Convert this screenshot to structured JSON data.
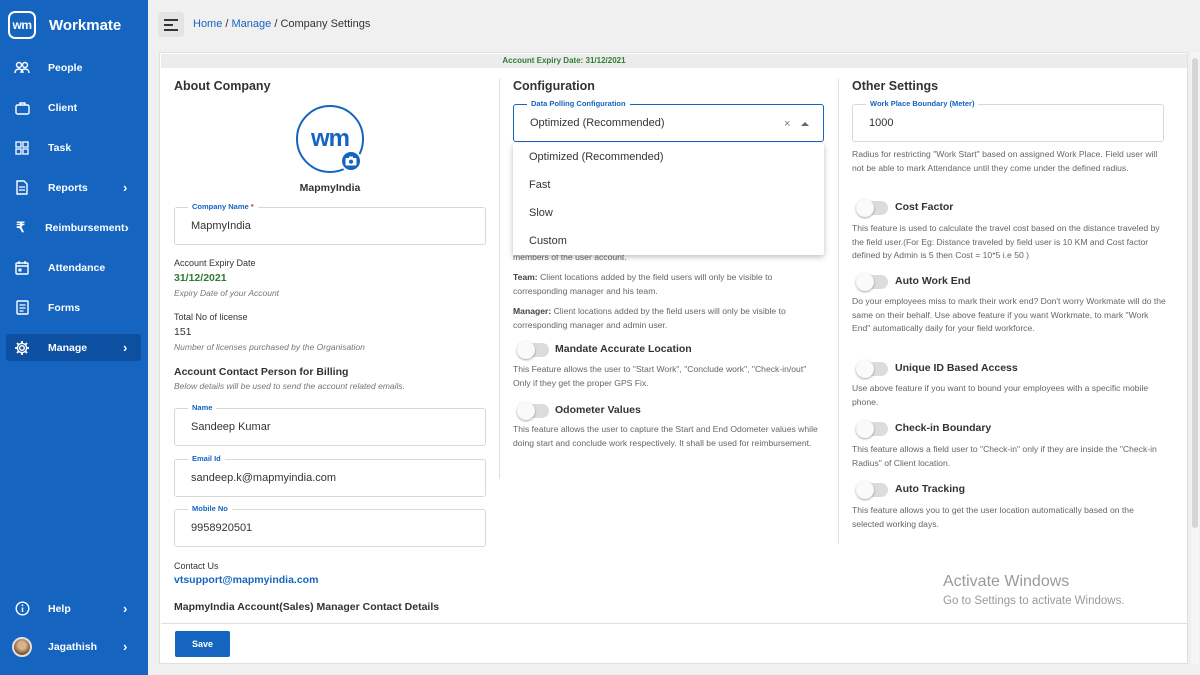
{
  "app": {
    "logo_text": "wm",
    "name": "Workmate"
  },
  "sidebar": {
    "items": [
      {
        "label": "People",
        "icon": "people-icon",
        "chevron": ""
      },
      {
        "label": "Client",
        "icon": "briefcase-icon",
        "chevron": ""
      },
      {
        "label": "Task",
        "icon": "grid-icon",
        "chevron": ""
      },
      {
        "label": "Reports",
        "icon": "document-icon",
        "chevron": "›"
      },
      {
        "label": "Reimbursement",
        "icon": "rupee-icon",
        "chevron": "›"
      },
      {
        "label": "Attendance",
        "icon": "calendar-icon",
        "chevron": ""
      },
      {
        "label": "Forms",
        "icon": "form-icon",
        "chevron": ""
      },
      {
        "label": "Manage",
        "icon": "gear-icon",
        "chevron": "›"
      }
    ],
    "help": {
      "label": "Help",
      "chevron": "›"
    },
    "user": {
      "label": "Jagathish",
      "chevron": "›"
    }
  },
  "breadcrumb": {
    "home": "Home",
    "sep1": " / ",
    "manage": "Manage",
    "sep2": " / ",
    "current": "Company Settings"
  },
  "banner": {
    "text": "Account Expiry Date: 31/12/2021"
  },
  "about": {
    "title": "About Company",
    "logo_text": "wm",
    "company_caption": "MapmyIndia",
    "company_name": {
      "label": "Company Name",
      "required": "*",
      "value": "MapmyIndia"
    },
    "expiry": {
      "label": "Account Expiry Date",
      "value": "31/12/2021",
      "hint": "Expiry Date of your Account"
    },
    "license": {
      "label": "Total No of license",
      "value": "151",
      "hint": "Number of licenses purchased by the Organisation"
    },
    "billing": {
      "title": "Account Contact Person for Billing",
      "hint": "Below details will be used to send the account related emails."
    },
    "name": {
      "label": "Name",
      "value": "Sandeep Kumar"
    },
    "email": {
      "label": "Email Id",
      "value": "sandeep.k@mapmyindia.com"
    },
    "mobile": {
      "label": "Mobile No",
      "value": "9958920501"
    },
    "contact": {
      "label": "Contact Us",
      "value": "vtsupport@mapmyindia.com"
    },
    "sales_title": "MapmyIndia Account(Sales) Manager Contact Details"
  },
  "configuration": {
    "title": "Configuration",
    "polling": {
      "label": "Data Polling Configuration",
      "value": "Optimized (Recommended)",
      "clear": "×",
      "options": [
        "Optimized (Recommended)",
        "Fast",
        "Slow",
        "Custom"
      ]
    },
    "partial_desc": "members of the user account.",
    "team_label": "Team:",
    "team_desc": " Client locations added by the field users will only be visible to corresponding manager and his team.",
    "manager_label": "Manager:",
    "manager_desc": " Client locations added by the field users will only be visible to corresponding manager and admin user.",
    "mandate": {
      "label": "Mandate Accurate Location",
      "desc": "This Feature allows the user to \"Start Work\", \"Conclude work\", \"Check-in/out\" Only if they get the proper GPS Fix."
    },
    "odometer": {
      "label": "Odometer Values",
      "desc": "This feature allows the user to capture the Start and End Odometer values while doing start and conclude work respectively. It shall be used for reimbursement."
    }
  },
  "other": {
    "title": "Other Settings",
    "boundary": {
      "label": "Work Place Boundary (Meter)",
      "value": "1000",
      "desc": "Radius for restricting \"Work Start\" based on assigned Work Place. Field user will not be able to mark Attendance until they come under the defined radius."
    },
    "cost_factor": {
      "label": "Cost Factor",
      "desc": "This feature is used to calculate the travel cost based on the distance traveled by the field user.(For Eg: Distance traveled by field user is 10 KM and Cost factor defined by Admin is 5 then Cost = 10*5 i.e 50 )"
    },
    "auto_work_end": {
      "label": "Auto Work End",
      "desc": "Do your employees miss to mark their work end? Don't worry Workmate will do the same on their behalf. Use above feature if you want Workmate, to mark \"Work End\" automatically daily for your field workforce."
    },
    "unique_id": {
      "label": "Unique ID Based Access",
      "desc": "Use above feature if you want to bound your employees with a specific mobile phone."
    },
    "checkin_boundary": {
      "label": "Check-in Boundary",
      "desc": "This feature allows a field user to \"Check-in\" only if they are inside the \"Check-in Radius\" of Client location."
    },
    "auto_tracking": {
      "label": "Auto Tracking",
      "desc": "This feature allows you to get the user location automatically based on the selected working days."
    }
  },
  "footer": {
    "save_label": "Save"
  },
  "watermark": {
    "title": "Activate Windows",
    "subtitle": "Go to Settings to activate Windows."
  },
  "colors": {
    "primary": "#1565c0",
    "sidebar": "#1565c0",
    "expiry_green": "#2e7d32"
  }
}
